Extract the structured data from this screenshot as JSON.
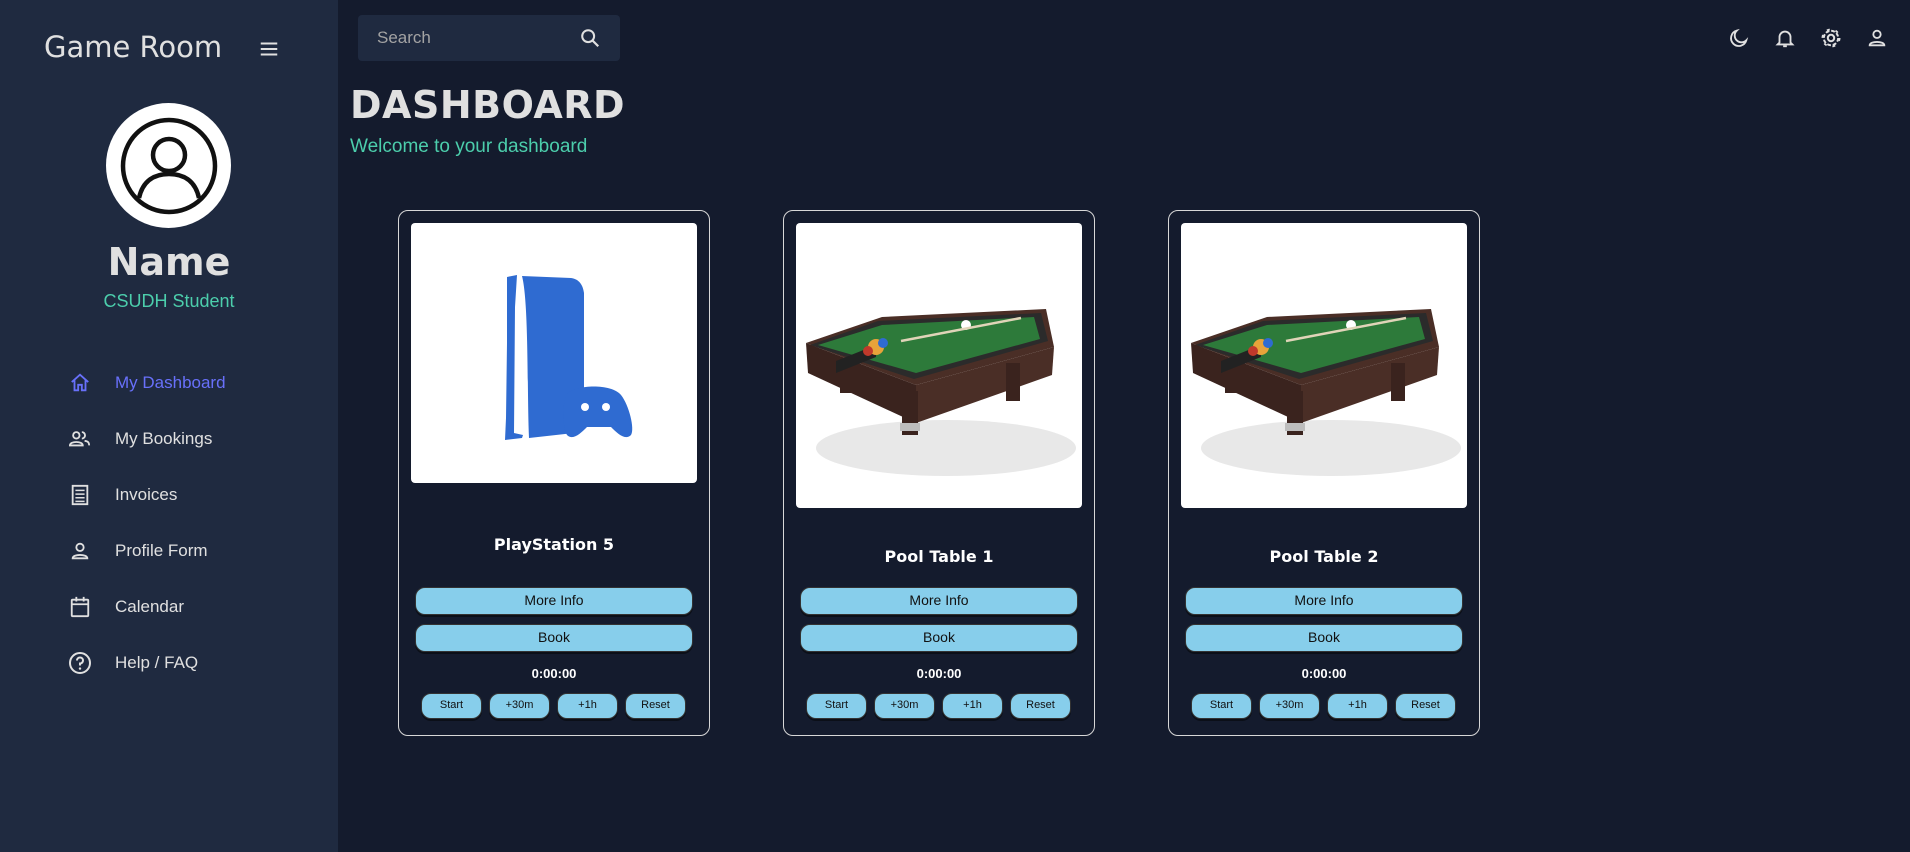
{
  "sidebar": {
    "brand": "Game Room",
    "user_name": "Name",
    "user_role": "CSUDH Student",
    "items": [
      {
        "label": "My Dashboard",
        "icon": "home-icon"
      },
      {
        "label": "My Bookings",
        "icon": "people-icon"
      },
      {
        "label": "Invoices",
        "icon": "receipt-icon"
      },
      {
        "label": "Profile Form",
        "icon": "person-icon"
      },
      {
        "label": "Calendar",
        "icon": "calendar-icon"
      },
      {
        "label": "Help / FAQ",
        "icon": "help-circle-icon"
      }
    ]
  },
  "topbar": {
    "search_placeholder": "Search",
    "icons": [
      "dark-mode-icon",
      "notifications-icon",
      "settings-icon",
      "account-icon"
    ]
  },
  "header": {
    "title": "DASHBOARD",
    "subtitle": "Welcome to your dashboard"
  },
  "cards": [
    {
      "title": "PlayStation 5",
      "more_info": "More Info",
      "book": "Book",
      "timer": "0:00:00",
      "start": "Start",
      "add30": "+30m",
      "add1h": "+1h",
      "reset": "Reset"
    },
    {
      "title": "Pool Table 1",
      "more_info": "More Info",
      "book": "Book",
      "timer": "0:00:00",
      "start": "Start",
      "add30": "+30m",
      "add1h": "+1h",
      "reset": "Reset"
    },
    {
      "title": "Pool Table 2",
      "more_info": "More Info",
      "book": "Book",
      "timer": "0:00:00",
      "start": "Start",
      "add30": "+30m",
      "add1h": "+1h",
      "reset": "Reset"
    }
  ],
  "colors": {
    "background": "#141b2d",
    "sidebar": "#1f2a40",
    "accent_green": "#4cceac",
    "accent_active": "#6870fa",
    "button": "#87ceeb"
  }
}
